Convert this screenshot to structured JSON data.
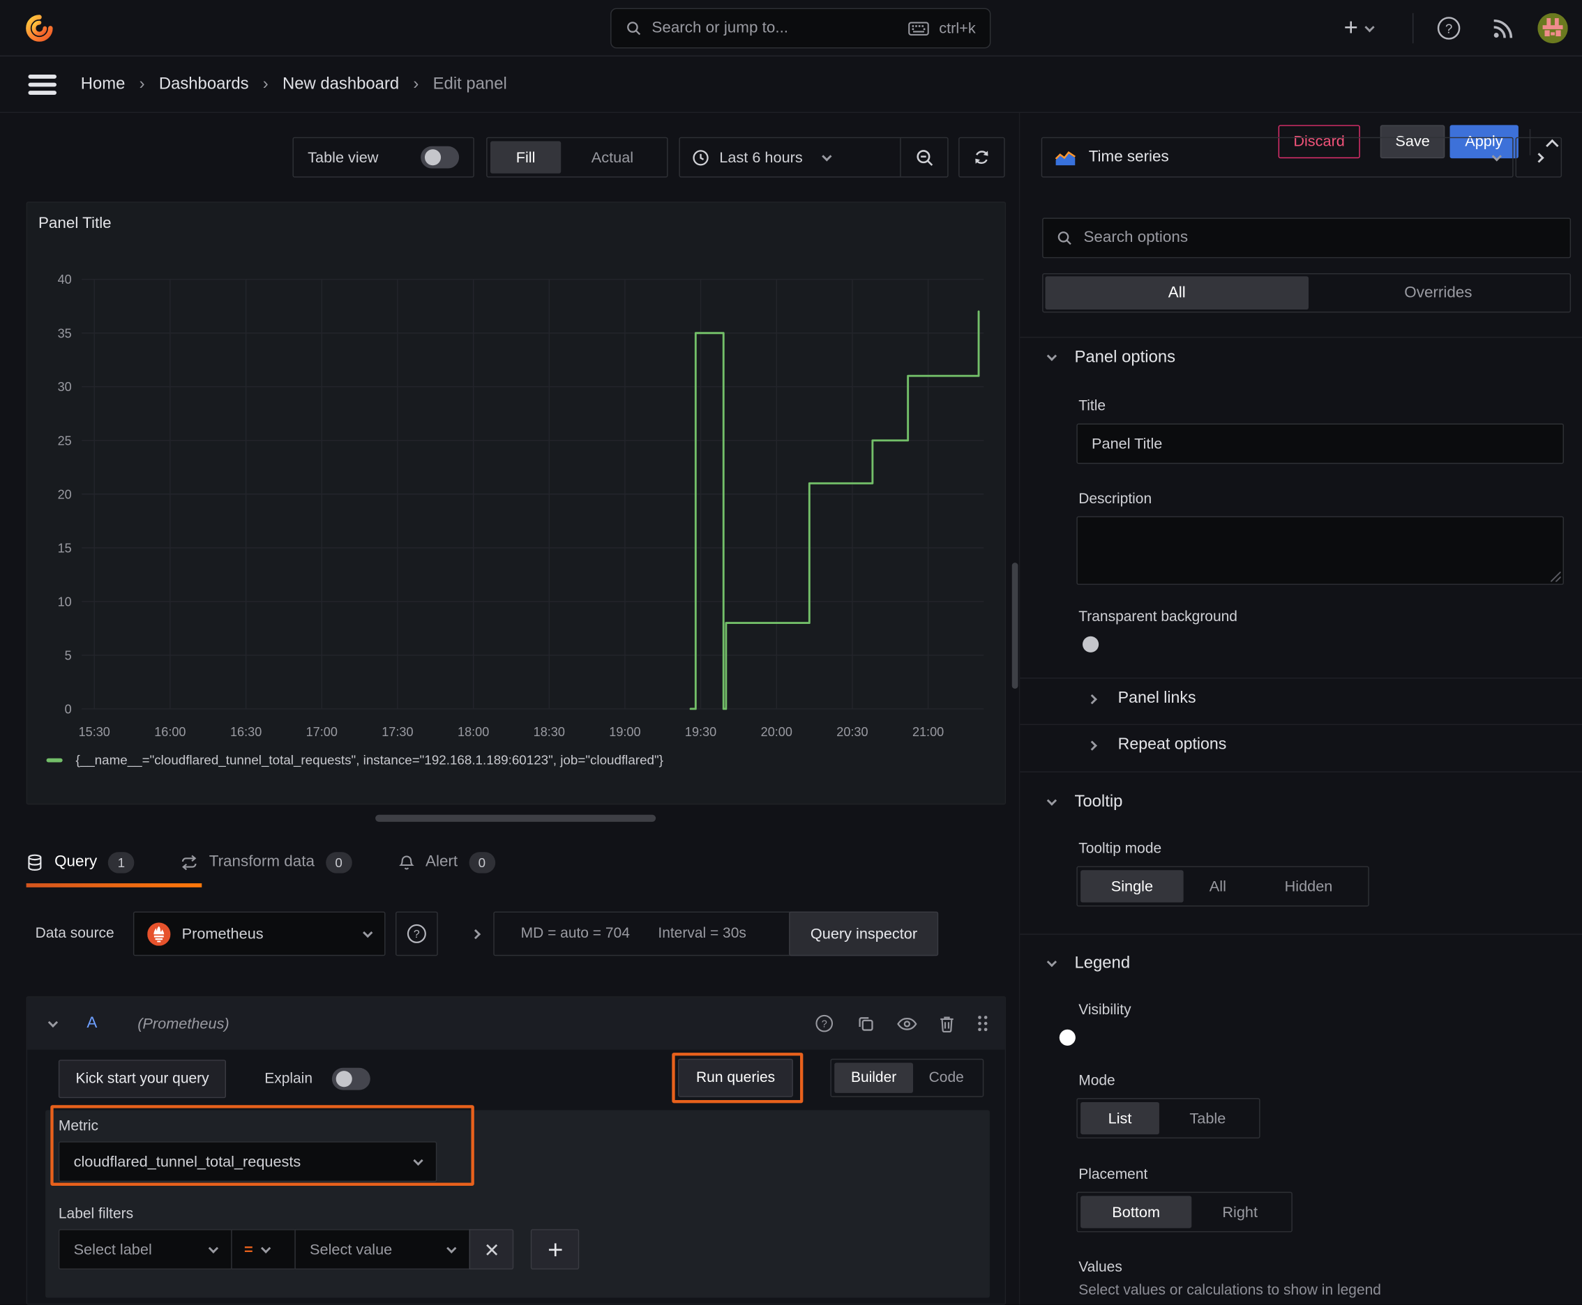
{
  "topbar": {
    "search_placeholder": "Search or jump to...",
    "shortcut": "ctrl+k"
  },
  "breadcrumb": {
    "items": [
      "Home",
      "Dashboards",
      "New dashboard",
      "Edit panel"
    ]
  },
  "header_actions": {
    "discard": "Discard",
    "save": "Save",
    "apply": "Apply"
  },
  "toolbar": {
    "table_view": "Table view",
    "fill": "Fill",
    "actual": "Actual",
    "time_range": "Last 6 hours"
  },
  "viz_picker": {
    "label": "Time series"
  },
  "panel": {
    "title": "Panel Title"
  },
  "chart_data": {
    "type": "line",
    "title": "Panel Title",
    "x_ticks": [
      "15:30",
      "16:00",
      "16:30",
      "17:00",
      "17:30",
      "18:00",
      "18:30",
      "19:00",
      "19:30",
      "20:00",
      "20:30",
      "21:00"
    ],
    "y_ticks": [
      0,
      5,
      10,
      15,
      20,
      25,
      30,
      35,
      40
    ],
    "ylim": [
      0,
      40
    ],
    "x_range": [
      "15:25",
      "21:22"
    ],
    "grid": true,
    "legend_position": "bottom",
    "series": [
      {
        "name": "{__name__=\"cloudflared_tunnel_total_requests\", instance=\"192.168.1.189:60123\", job=\"cloudflared\"}",
        "color": "#73bf69",
        "points": [
          [
            "19:26",
            0
          ],
          [
            "19:28",
            0
          ],
          [
            "19:28",
            35
          ],
          [
            "19:39",
            35
          ],
          [
            "19:39",
            0
          ],
          [
            "19:40",
            0
          ],
          [
            "19:40",
            8
          ],
          [
            "20:13",
            8
          ],
          [
            "20:13",
            21
          ],
          [
            "20:38",
            21
          ],
          [
            "20:38",
            25
          ],
          [
            "20:52",
            25
          ],
          [
            "20:52",
            31
          ],
          [
            "21:20",
            31
          ],
          [
            "21:20",
            37
          ]
        ]
      }
    ]
  },
  "tabs": {
    "query": {
      "label": "Query",
      "count": "1"
    },
    "transform": {
      "label": "Transform data",
      "count": "0"
    },
    "alert": {
      "label": "Alert",
      "count": "0"
    }
  },
  "datasource": {
    "label": "Data source",
    "name": "Prometheus",
    "md": "MD = auto = 704",
    "interval": "Interval = 30s",
    "inspector": "Query inspector"
  },
  "query_editor": {
    "ref": "A",
    "hint": "(Prometheus)",
    "kickstart": "Kick start your query",
    "explain": "Explain",
    "run": "Run queries",
    "builder": "Builder",
    "code": "Code",
    "metric": {
      "label": "Metric",
      "value": "cloudflared_tunnel_total_requests"
    },
    "filters": {
      "label": "Label filters",
      "select_label": "Select label",
      "operator": "=",
      "select_value": "Select value"
    }
  },
  "options": {
    "search_placeholder": "Search options",
    "tabs": {
      "all": "All",
      "overrides": "Overrides"
    },
    "panel_options": {
      "title": "Panel options",
      "title_label": "Title",
      "title_value": "Panel Title",
      "description_label": "Description",
      "transparent_label": "Transparent background",
      "links": "Panel links",
      "repeat": "Repeat options"
    },
    "tooltip": {
      "title": "Tooltip",
      "mode_label": "Tooltip mode",
      "single": "Single",
      "all": "All",
      "hidden": "Hidden"
    },
    "legend": {
      "title": "Legend",
      "visibility_label": "Visibility",
      "mode_label": "Mode",
      "list": "List",
      "table": "Table",
      "placement_label": "Placement",
      "bottom": "Bottom",
      "right": "Right",
      "values_label": "Values",
      "values_hint": "Select values or calculations to show in legend"
    }
  },
  "colors": {
    "accent_orange": "#e8611c",
    "tab_underline": "#ff780a",
    "series_green": "#73bf69",
    "apply_blue": "#3d71d9",
    "discard_pink": "#e02f6d",
    "ref_id_blue": "#6e9fff"
  }
}
